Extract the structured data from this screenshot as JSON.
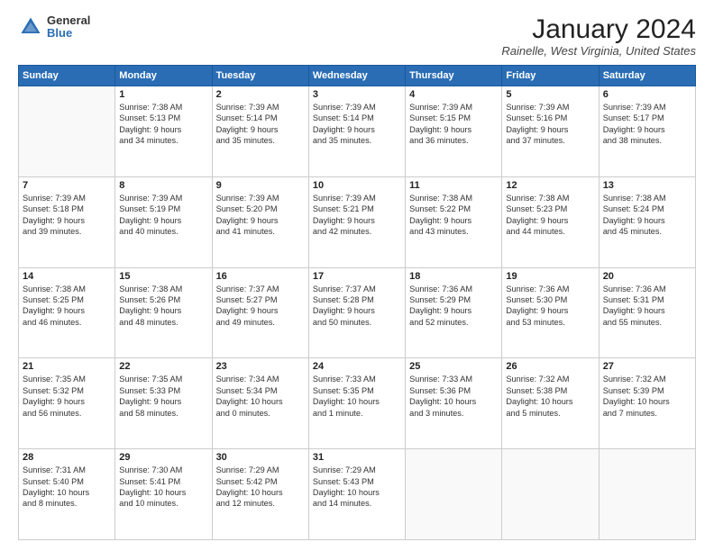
{
  "logo": {
    "general": "General",
    "blue": "Blue"
  },
  "header": {
    "month": "January 2024",
    "location": "Rainelle, West Virginia, United States"
  },
  "weekdays": [
    "Sunday",
    "Monday",
    "Tuesday",
    "Wednesday",
    "Thursday",
    "Friday",
    "Saturday"
  ],
  "weeks": [
    [
      {
        "day": "",
        "info": ""
      },
      {
        "day": "1",
        "info": "Sunrise: 7:38 AM\nSunset: 5:13 PM\nDaylight: 9 hours\nand 34 minutes."
      },
      {
        "day": "2",
        "info": "Sunrise: 7:39 AM\nSunset: 5:14 PM\nDaylight: 9 hours\nand 35 minutes."
      },
      {
        "day": "3",
        "info": "Sunrise: 7:39 AM\nSunset: 5:14 PM\nDaylight: 9 hours\nand 35 minutes."
      },
      {
        "day": "4",
        "info": "Sunrise: 7:39 AM\nSunset: 5:15 PM\nDaylight: 9 hours\nand 36 minutes."
      },
      {
        "day": "5",
        "info": "Sunrise: 7:39 AM\nSunset: 5:16 PM\nDaylight: 9 hours\nand 37 minutes."
      },
      {
        "day": "6",
        "info": "Sunrise: 7:39 AM\nSunset: 5:17 PM\nDaylight: 9 hours\nand 38 minutes."
      }
    ],
    [
      {
        "day": "7",
        "info": "Sunrise: 7:39 AM\nSunset: 5:18 PM\nDaylight: 9 hours\nand 39 minutes."
      },
      {
        "day": "8",
        "info": "Sunrise: 7:39 AM\nSunset: 5:19 PM\nDaylight: 9 hours\nand 40 minutes."
      },
      {
        "day": "9",
        "info": "Sunrise: 7:39 AM\nSunset: 5:20 PM\nDaylight: 9 hours\nand 41 minutes."
      },
      {
        "day": "10",
        "info": "Sunrise: 7:39 AM\nSunset: 5:21 PM\nDaylight: 9 hours\nand 42 minutes."
      },
      {
        "day": "11",
        "info": "Sunrise: 7:38 AM\nSunset: 5:22 PM\nDaylight: 9 hours\nand 43 minutes."
      },
      {
        "day": "12",
        "info": "Sunrise: 7:38 AM\nSunset: 5:23 PM\nDaylight: 9 hours\nand 44 minutes."
      },
      {
        "day": "13",
        "info": "Sunrise: 7:38 AM\nSunset: 5:24 PM\nDaylight: 9 hours\nand 45 minutes."
      }
    ],
    [
      {
        "day": "14",
        "info": "Sunrise: 7:38 AM\nSunset: 5:25 PM\nDaylight: 9 hours\nand 46 minutes."
      },
      {
        "day": "15",
        "info": "Sunrise: 7:38 AM\nSunset: 5:26 PM\nDaylight: 9 hours\nand 48 minutes."
      },
      {
        "day": "16",
        "info": "Sunrise: 7:37 AM\nSunset: 5:27 PM\nDaylight: 9 hours\nand 49 minutes."
      },
      {
        "day": "17",
        "info": "Sunrise: 7:37 AM\nSunset: 5:28 PM\nDaylight: 9 hours\nand 50 minutes."
      },
      {
        "day": "18",
        "info": "Sunrise: 7:36 AM\nSunset: 5:29 PM\nDaylight: 9 hours\nand 52 minutes."
      },
      {
        "day": "19",
        "info": "Sunrise: 7:36 AM\nSunset: 5:30 PM\nDaylight: 9 hours\nand 53 minutes."
      },
      {
        "day": "20",
        "info": "Sunrise: 7:36 AM\nSunset: 5:31 PM\nDaylight: 9 hours\nand 55 minutes."
      }
    ],
    [
      {
        "day": "21",
        "info": "Sunrise: 7:35 AM\nSunset: 5:32 PM\nDaylight: 9 hours\nand 56 minutes."
      },
      {
        "day": "22",
        "info": "Sunrise: 7:35 AM\nSunset: 5:33 PM\nDaylight: 9 hours\nand 58 minutes."
      },
      {
        "day": "23",
        "info": "Sunrise: 7:34 AM\nSunset: 5:34 PM\nDaylight: 10 hours\nand 0 minutes."
      },
      {
        "day": "24",
        "info": "Sunrise: 7:33 AM\nSunset: 5:35 PM\nDaylight: 10 hours\nand 1 minute."
      },
      {
        "day": "25",
        "info": "Sunrise: 7:33 AM\nSunset: 5:36 PM\nDaylight: 10 hours\nand 3 minutes."
      },
      {
        "day": "26",
        "info": "Sunrise: 7:32 AM\nSunset: 5:38 PM\nDaylight: 10 hours\nand 5 minutes."
      },
      {
        "day": "27",
        "info": "Sunrise: 7:32 AM\nSunset: 5:39 PM\nDaylight: 10 hours\nand 7 minutes."
      }
    ],
    [
      {
        "day": "28",
        "info": "Sunrise: 7:31 AM\nSunset: 5:40 PM\nDaylight: 10 hours\nand 8 minutes."
      },
      {
        "day": "29",
        "info": "Sunrise: 7:30 AM\nSunset: 5:41 PM\nDaylight: 10 hours\nand 10 minutes."
      },
      {
        "day": "30",
        "info": "Sunrise: 7:29 AM\nSunset: 5:42 PM\nDaylight: 10 hours\nand 12 minutes."
      },
      {
        "day": "31",
        "info": "Sunrise: 7:29 AM\nSunset: 5:43 PM\nDaylight: 10 hours\nand 14 minutes."
      },
      {
        "day": "",
        "info": ""
      },
      {
        "day": "",
        "info": ""
      },
      {
        "day": "",
        "info": ""
      }
    ]
  ]
}
